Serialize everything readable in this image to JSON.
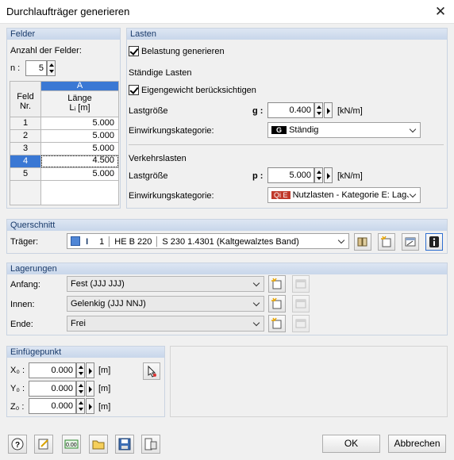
{
  "window": {
    "title": "Durchlaufträger generieren",
    "close_glyph": "✕"
  },
  "felder": {
    "header": "Felder",
    "count_label": "Anzahl der Felder:",
    "n_label": "n :",
    "n_value": "5",
    "table": {
      "col_letter": "A",
      "row_header_1": "Feld",
      "row_header_2": "Nr.",
      "col_header_1": "Länge",
      "col_header_2": "Lᵢ [m]",
      "rows": [
        {
          "nr": "1",
          "value": "5.000"
        },
        {
          "nr": "2",
          "value": "5.000"
        },
        {
          "nr": "3",
          "value": "5.000"
        },
        {
          "nr": "4",
          "value": "4.500"
        },
        {
          "nr": "5",
          "value": "5.000"
        }
      ]
    }
  },
  "lasten": {
    "header": "Lasten",
    "generate_label": "Belastung generieren",
    "permanent_title": "Ständige Lasten",
    "selfweight_label": "Eigengewicht berücksichtigen",
    "perm_size_label": "Lastgröße",
    "perm_symbol": "g :",
    "perm_value": "0.400",
    "perm_unit": "[kN/m]",
    "perm_cat_label": "Einwirkungskategorie:",
    "perm_cat_badge": "G",
    "perm_cat_value": "Ständig",
    "traffic_title": "Verkehrslasten",
    "traffic_size_label": "Lastgröße",
    "traffic_symbol": "p :",
    "traffic_value": "5.000",
    "traffic_unit": "[kN/m]",
    "traffic_cat_label": "Einwirkungskategorie:",
    "traffic_cat_badge": "Qi E",
    "traffic_cat_value": "Nutzlasten - Kategorie E: Lage"
  },
  "querschnitt": {
    "header": "Querschnitt",
    "traeger_label": "Träger:",
    "index": "1",
    "profile": "HE B 220",
    "material": "S 230 1.4301 (Kaltgewalztes Band)",
    "color": "#4f86d6"
  },
  "lagerungen": {
    "header": "Lagerungen",
    "rows": [
      {
        "label": "Anfang:",
        "value": "Fest (JJJ JJJ)"
      },
      {
        "label": "Innen:",
        "value": "Gelenkig (JJJ NNJ)"
      },
      {
        "label": "Ende:",
        "value": "Frei"
      }
    ]
  },
  "einfuegepunkt": {
    "header": "Einfügepunkt",
    "rows": [
      {
        "label": "X₀ :",
        "value": "0.000",
        "unit": "[m]"
      },
      {
        "label": "Y₀ :",
        "value": "0.000",
        "unit": "[m]"
      },
      {
        "label": "Z₀ :",
        "value": "0.000",
        "unit": "[m]"
      }
    ]
  },
  "buttons": {
    "ok": "OK",
    "cancel": "Abbrechen"
  },
  "icons": {
    "toolbar": [
      "help-icon",
      "edit-icon",
      "units-icon",
      "open-icon",
      "save-icon",
      "export-icon"
    ]
  },
  "colors": {
    "group_header_text": "#1a3b6b",
    "selected_row": "#3a78d4",
    "col_header": "#3a78d4"
  }
}
